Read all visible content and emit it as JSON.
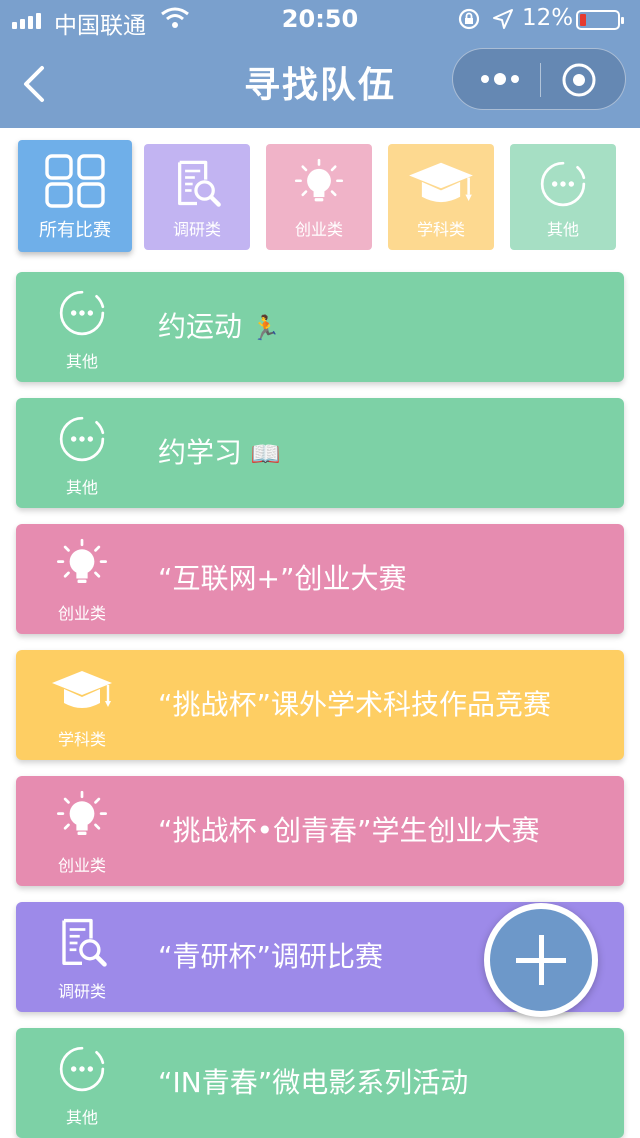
{
  "status_bar": {
    "carrier": "中国联通",
    "time": "20:50",
    "battery": "12%"
  },
  "nav": {
    "title": "寻找队伍"
  },
  "tabs": [
    {
      "label": "所有比赛",
      "icon": "grid-icon",
      "color": "#6fafe9"
    },
    {
      "label": "调研类",
      "icon": "document-search-icon",
      "color": "#c2b4f2"
    },
    {
      "label": "创业类",
      "icon": "lightbulb-icon",
      "color": "#f0b3c8"
    },
    {
      "label": "学科类",
      "icon": "graduation-cap-icon",
      "color": "#fdd990"
    },
    {
      "label": "其他",
      "icon": "more-circle-icon",
      "color": "#a6dfc4"
    }
  ],
  "cards": [
    {
      "category": "其他",
      "title": "约运动",
      "emoji": "🏃",
      "icon": "more-circle-icon",
      "color": "#7dd1a6"
    },
    {
      "category": "其他",
      "title": "约学习",
      "emoji": "📖",
      "icon": "more-circle-icon",
      "color": "#7dd1a6"
    },
    {
      "category": "创业类",
      "title": "“互联网+”创业大赛",
      "icon": "lightbulb-icon",
      "color": "#e68cb0"
    },
    {
      "category": "学科类",
      "title": "“挑战杯”课外学术科技作品竞赛",
      "icon": "graduation-cap-icon",
      "color": "#fece63"
    },
    {
      "category": "创业类",
      "title": "“挑战杯•创青春”学生创业大赛",
      "icon": "lightbulb-icon",
      "color": "#e68cb0"
    },
    {
      "category": "调研类",
      "title": "“青研杯”调研比赛",
      "icon": "document-search-icon",
      "color": "#9d8ae9"
    },
    {
      "category": "其他",
      "title": "“IN青春”微电影系列活动",
      "icon": "more-circle-icon",
      "color": "#7dd1a6"
    }
  ]
}
